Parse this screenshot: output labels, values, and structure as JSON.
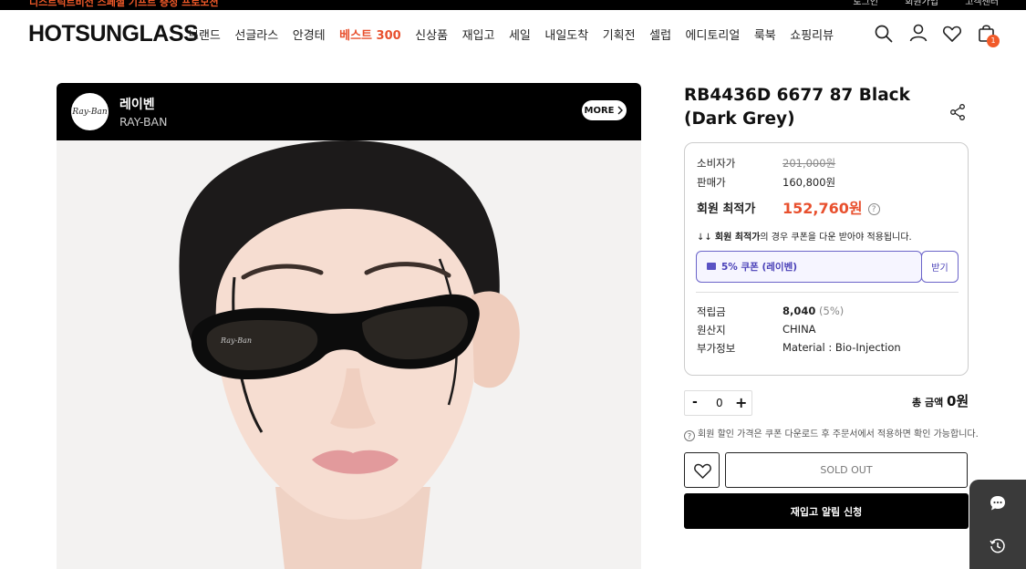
{
  "topbar": {
    "promo": "디스트릭트비전 스페셜 기프트 증정 프로모션",
    "util_links": [
      "로그인",
      "회원가입",
      "고객센터"
    ]
  },
  "header": {
    "logo": "HOTSUNGLASS",
    "nav": [
      "브랜드",
      "선글라스",
      "안경테",
      "베스트 300",
      "신상품",
      "재입고",
      "세일",
      "내일도착",
      "기획전",
      "셀럽",
      "에디토리얼",
      "룩북",
      "쇼핑리뷰"
    ],
    "highlight_index": 3,
    "cart_count": "1",
    "icons": [
      "search-icon",
      "user-icon",
      "heart-icon",
      "shopping-bag-icon"
    ]
  },
  "brand": {
    "logo_text": "Ray-Ban",
    "name": "레이벤",
    "sub": "RAY-BAN",
    "more_label": "MORE"
  },
  "product": {
    "title": "RB4436D 6677 87 Black (Dark Grey)"
  },
  "price": {
    "consumer_label": "소비자가",
    "consumer_value": "201,000원",
    "sale_label": "판매가",
    "sale_value": "160,800원",
    "best_label": "회원 최적가",
    "best_value": "152,760원",
    "note_prefix": "↓↓ ",
    "note_bold": "회원 최적가",
    "note_rest": "의 경우 쿠폰을 다운 받아야 적용됩니다.",
    "coupon_text": "5% 쿠폰 (레이벤)",
    "coupon_button": "받기",
    "points_label": "적립금",
    "points_value": "8,040",
    "points_rate": "(5%)",
    "origin_label": "원산지",
    "origin_value": "CHINA",
    "extra_label": "부가정보",
    "extra_value": "Material : Bio-Injection"
  },
  "order": {
    "minus": "-",
    "quantity": "0",
    "plus": "+",
    "total_label": "총 금액",
    "total_value": "0원",
    "info": "회원 할인 가격은 쿠폰 다운로드 후 주문서에서 적용하면 확인 가능합니다.",
    "soldout_label": "SOLD OUT",
    "restock_label": "재입고 알림 신청"
  },
  "colors": {
    "accent": "#e8502e",
    "coupon": "#4a41b8",
    "dark": "#000000"
  }
}
